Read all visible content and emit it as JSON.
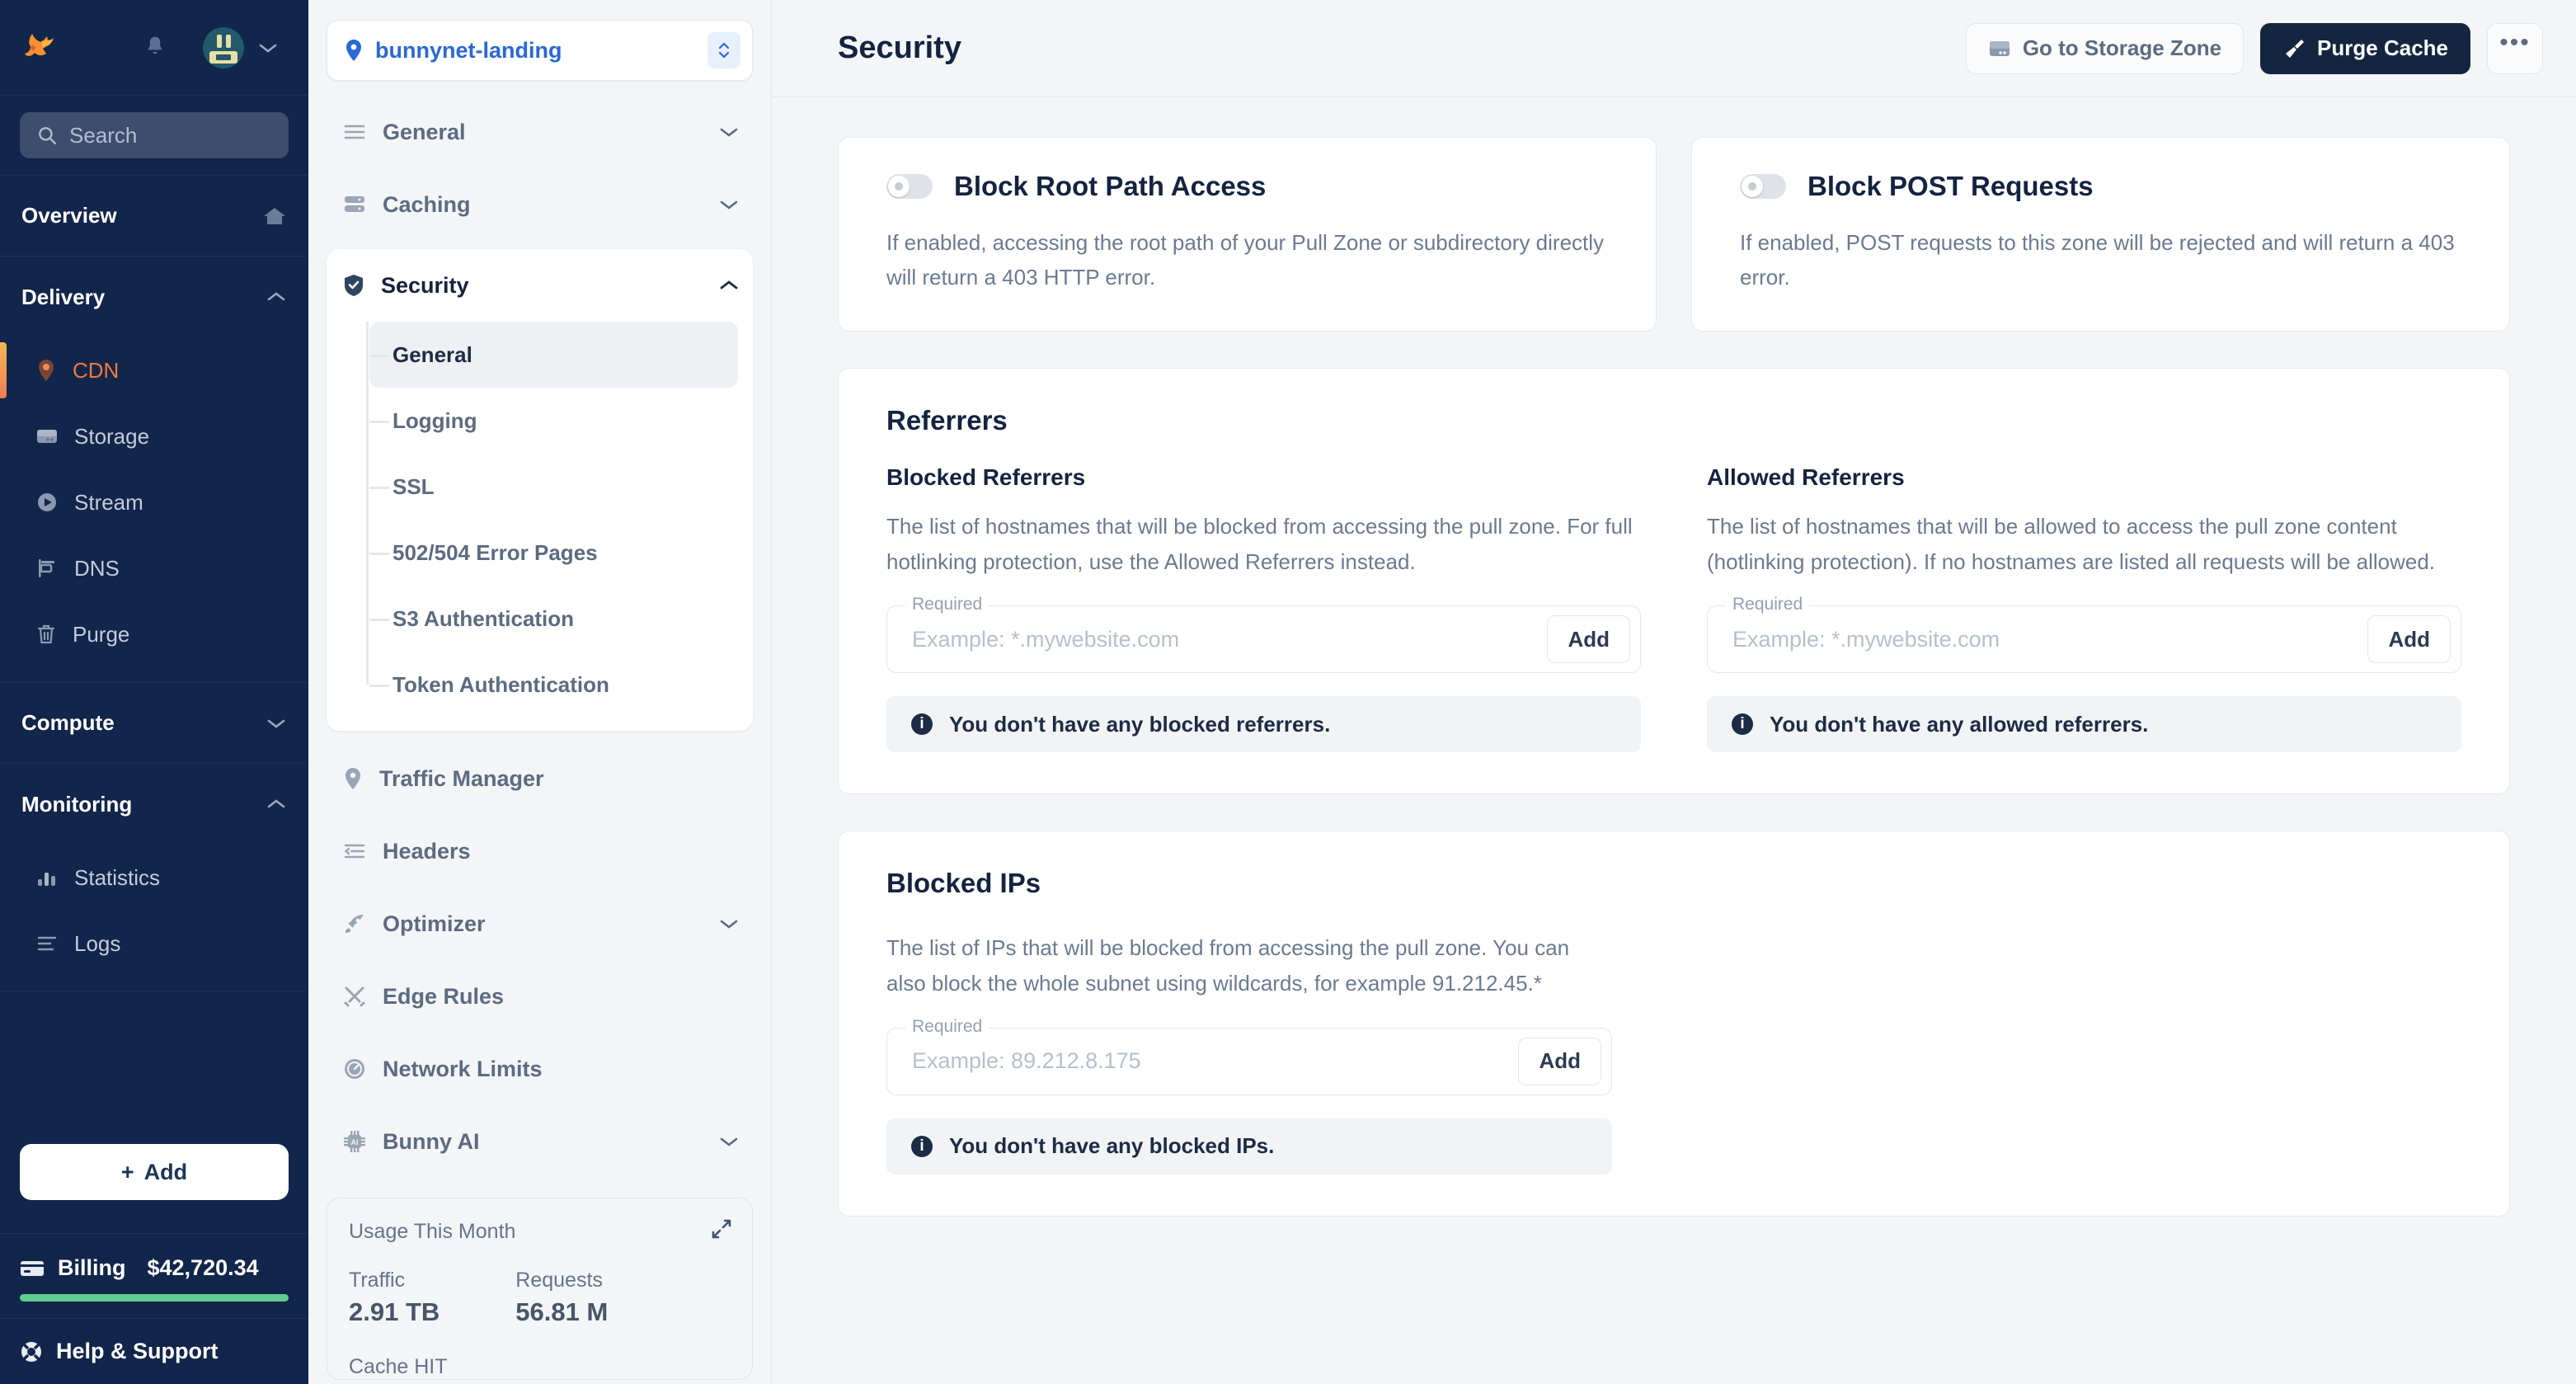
{
  "sidebar_primary": {
    "brand_icon": "bunny-logo-icon",
    "notification_icon": "bell-icon",
    "avatar_icon": "user-avatar",
    "account_caret_icon": "chevron-down-icon",
    "search": {
      "placeholder": "Search",
      "icon": "search-icon"
    },
    "overview": {
      "label": "Overview",
      "icon": "home-icon"
    },
    "groups": [
      {
        "label": "Delivery",
        "expanded": true,
        "chevron": "chevron-up-icon",
        "items": [
          {
            "label": "CDN",
            "icon": "map-pin-icon",
            "active": true
          },
          {
            "label": "Storage",
            "icon": "storage-icon",
            "active": false
          },
          {
            "label": "Stream",
            "icon": "play-circle-icon",
            "active": false
          },
          {
            "label": "DNS",
            "icon": "flag-icon",
            "active": false
          },
          {
            "label": "Purge",
            "icon": "trash-icon",
            "active": false
          }
        ]
      },
      {
        "label": "Compute",
        "expanded": false,
        "chevron": "chevron-down-icon",
        "items": []
      },
      {
        "label": "Monitoring",
        "expanded": true,
        "chevron": "chevron-up-icon",
        "items": [
          {
            "label": "Statistics",
            "icon": "bar-chart-icon",
            "active": false
          },
          {
            "label": "Logs",
            "icon": "list-icon",
            "active": false
          }
        ]
      }
    ],
    "add_button": {
      "label": "Add",
      "icon": "plus-icon"
    },
    "billing": {
      "label": "Billing",
      "amount": "$42,720.34",
      "icon": "credit-card-icon",
      "bar_color": "#5fcb8e"
    },
    "help": {
      "label": "Help & Support",
      "icon": "lifebuoy-icon"
    }
  },
  "sidebar_secondary": {
    "zone": {
      "name": "bunnynet-landing",
      "pin_icon": "map-pin-icon",
      "stepper_icon": "chevron-up-down-icon"
    },
    "items": [
      {
        "label": "General",
        "icon": "menu-icon",
        "chevron": "chevron-down-icon",
        "expandable": true
      },
      {
        "label": "Caching",
        "icon": "server-icon",
        "chevron": "chevron-down-icon",
        "expandable": true
      },
      {
        "label": "Security",
        "icon": "shield-check-icon",
        "chevron": "chevron-up-icon",
        "expandable": true,
        "active": true
      },
      {
        "label": "Traffic Manager",
        "icon": "map-pin-icon",
        "expandable": false
      },
      {
        "label": "Headers",
        "icon": "headers-icon",
        "expandable": false
      },
      {
        "label": "Optimizer",
        "icon": "rocket-icon",
        "chevron": "chevron-down-icon",
        "expandable": true
      },
      {
        "label": "Edge Rules",
        "icon": "tools-icon",
        "expandable": false
      },
      {
        "label": "Network Limits",
        "icon": "gauge-icon",
        "expandable": false
      },
      {
        "label": "Bunny AI",
        "icon": "ai-chip-icon",
        "chevron": "chevron-down-icon",
        "expandable": true
      }
    ],
    "security_submenu": [
      {
        "label": "General",
        "active": true
      },
      {
        "label": "Logging",
        "active": false
      },
      {
        "label": "SSL",
        "active": false
      },
      {
        "label": "502/504 Error Pages",
        "active": false
      },
      {
        "label": "S3 Authentication",
        "active": false
      },
      {
        "label": "Token Authentication",
        "active": false
      }
    ],
    "usage": {
      "title": "Usage This Month",
      "expand_icon": "expand-icon",
      "traffic_label": "Traffic",
      "traffic_value": "2.91 TB",
      "requests_label": "Requests",
      "requests_value": "56.81 M",
      "cache_hit_label": "Cache HIT"
    }
  },
  "header": {
    "title": "Security",
    "storage_zone_button": {
      "label": "Go to Storage Zone",
      "icon": "storage-icon"
    },
    "purge_cache_button": {
      "label": "Purge Cache",
      "icon": "broom-icon"
    },
    "more_button": {
      "label": "•••",
      "icon": "more-horizontal-icon"
    }
  },
  "main": {
    "toggles": [
      {
        "title": "Block Root Path Access",
        "description": "If enabled, accessing the root path of your Pull Zone or subdirectory directly will return a 403 HTTP error.",
        "enabled": false
      },
      {
        "title": "Block POST Requests",
        "description": "If enabled, POST requests to this zone will be rejected and will return a 403 error.",
        "enabled": false
      }
    ],
    "referrers": {
      "title": "Referrers",
      "blocked": {
        "title": "Blocked Referrers",
        "description": "The list of hostnames that will be blocked from accessing the pull zone. For full hotlinking protection, use the Allowed Referrers instead.",
        "field_legend": "Required",
        "placeholder": "Example: *.mywebsite.com",
        "value": "",
        "add_label": "Add",
        "notice": "You don't have any blocked referrers.",
        "notice_icon": "info-icon"
      },
      "allowed": {
        "title": "Allowed Referrers",
        "description": "The list of hostnames that will be allowed to access the pull zone content (hotlinking protection). If no hostnames are listed all requests will be allowed.",
        "field_legend": "Required",
        "placeholder": "Example: *.mywebsite.com",
        "value": "",
        "add_label": "Add",
        "notice": "You don't have any allowed referrers.",
        "notice_icon": "info-icon"
      }
    },
    "blocked_ips": {
      "title": "Blocked IPs",
      "description": "The list of IPs that will be blocked from accessing the pull zone. You can also block the whole subnet using wildcards, for example 91.212.45.*",
      "field_legend": "Required",
      "placeholder": "Example: 89.212.8.175",
      "value": "",
      "add_label": "Add",
      "notice": "You don't have any blocked IPs.",
      "notice_icon": "info-icon"
    }
  }
}
